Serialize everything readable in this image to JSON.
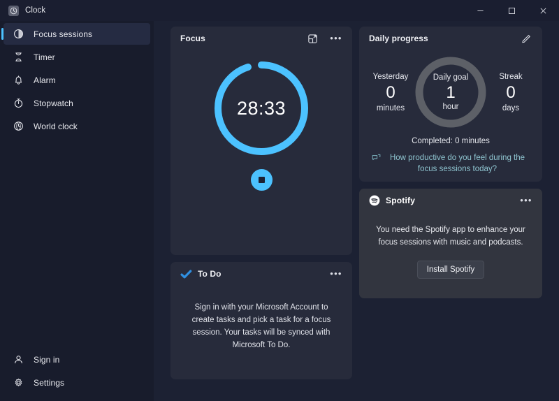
{
  "window": {
    "title": "Clock",
    "app_icon": "clock-icon",
    "controls": {
      "minimize": "minimize-icon",
      "maximize": "maximize-icon",
      "close": "close-icon"
    }
  },
  "sidebar": {
    "items": [
      {
        "label": "Focus sessions",
        "icon": "focus-sessions-icon",
        "selected": true
      },
      {
        "label": "Timer",
        "icon": "hourglass-icon",
        "selected": false
      },
      {
        "label": "Alarm",
        "icon": "bell-icon",
        "selected": false
      },
      {
        "label": "Stopwatch",
        "icon": "stopwatch-icon",
        "selected": false
      },
      {
        "label": "World clock",
        "icon": "globe-clock-icon",
        "selected": false
      }
    ],
    "bottom_items": [
      {
        "label": "Sign in",
        "icon": "person-icon"
      },
      {
        "label": "Settings",
        "icon": "gear-icon"
      }
    ]
  },
  "focus_card": {
    "title": "Focus",
    "popout_icon": "mini-view-icon",
    "more_icon": "more-options-icon",
    "timer_display": "28:33",
    "progress_percent": 95,
    "ring_color": "#4cc2ff",
    "ring_track_color": "#272b3b",
    "stop_button": "stop-session-button"
  },
  "todo_card": {
    "title": "To Do",
    "icon": "todo-check-icon",
    "more_icon": "more-options-icon",
    "message": "Sign in with your Microsoft Account to create tasks and pick a task for a focus session. Your tasks will be synced with Microsoft To Do."
  },
  "daily_progress_card": {
    "title": "Daily progress",
    "edit_icon": "pencil-edit-icon",
    "yesterday": {
      "label": "Yesterday",
      "value": "0",
      "unit": "minutes"
    },
    "daily_goal": {
      "label": "Daily goal",
      "value": "1",
      "unit": "hour",
      "ring_color": "#5d6067",
      "progress_percent": 0
    },
    "streak": {
      "label": "Streak",
      "value": "0",
      "unit": "days"
    },
    "completed_text": "Completed: 0 minutes",
    "survey": {
      "icon": "feedback-icon",
      "text": "How productive do you feel during the focus sessions today?",
      "color": "#8fc5d0"
    }
  },
  "spotify_card": {
    "title": "Spotify",
    "logo_icon": "spotify-logo-icon",
    "more_icon": "more-options-icon",
    "message": "You need the Spotify app to enhance your focus sessions with music and podcasts.",
    "install_button": "Install Spotify"
  },
  "theme": {
    "accent": "#4cc2ff",
    "page_background": "#1c2133",
    "sidebar_background": "#181c2c",
    "card_background": "#272b3b",
    "card_background_dark": "#32353f"
  }
}
